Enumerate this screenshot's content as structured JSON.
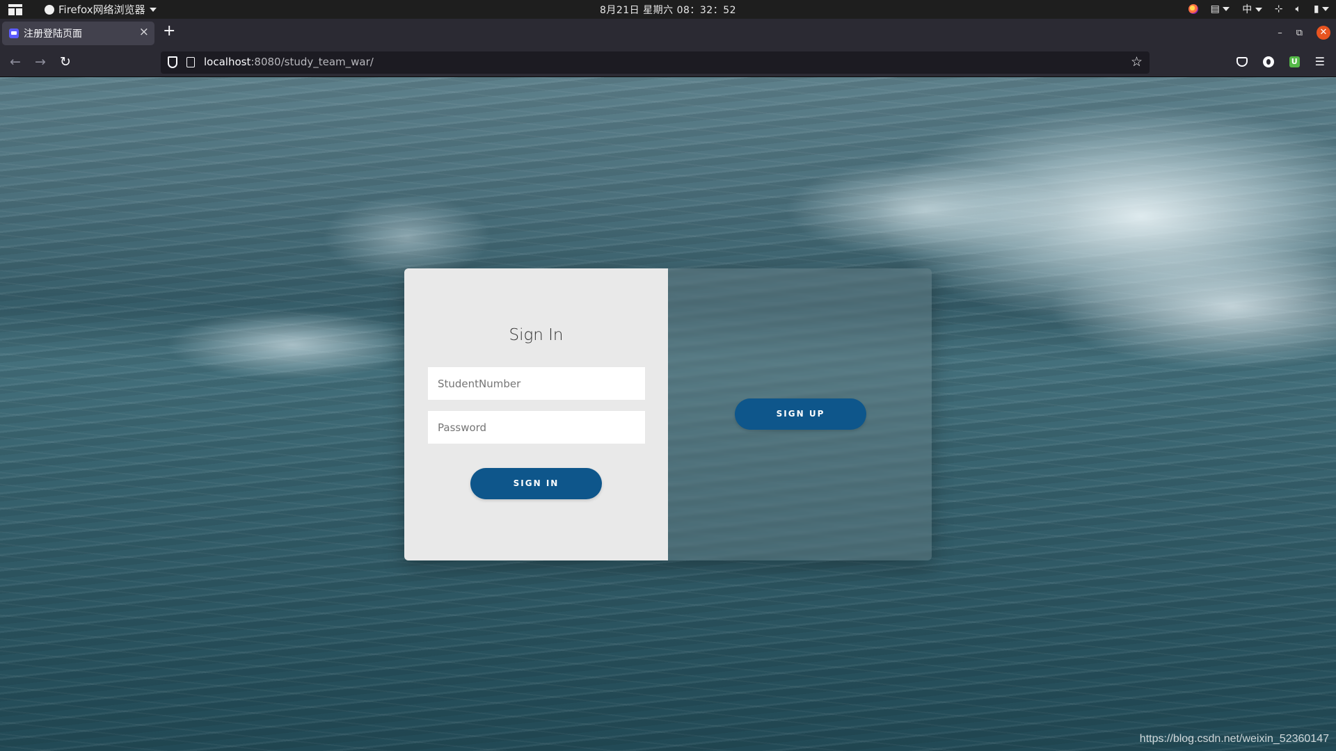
{
  "desktop": {
    "app_menu_label": "Firefox网络浏览器",
    "clock": "8月21日 星期六  08：32：52",
    "input_method": "中"
  },
  "browser": {
    "tab_title": "注册登陆页面",
    "tab_close": "×",
    "new_tab": "+",
    "url_host": "localhost",
    "url_path": ":8080/study_team_war/"
  },
  "form": {
    "title": "Sign In",
    "student_number_placeholder": "StudentNumber",
    "password_placeholder": "Password",
    "signin_button": "SIGN IN",
    "signup_button": "SIGN UP"
  },
  "watermark": "https://blog.csdn.net/weixin_52360147",
  "colors": {
    "button_blue": "#0e568b",
    "panel_bg": "#e9e9e9",
    "close_orange": "#e95420"
  }
}
